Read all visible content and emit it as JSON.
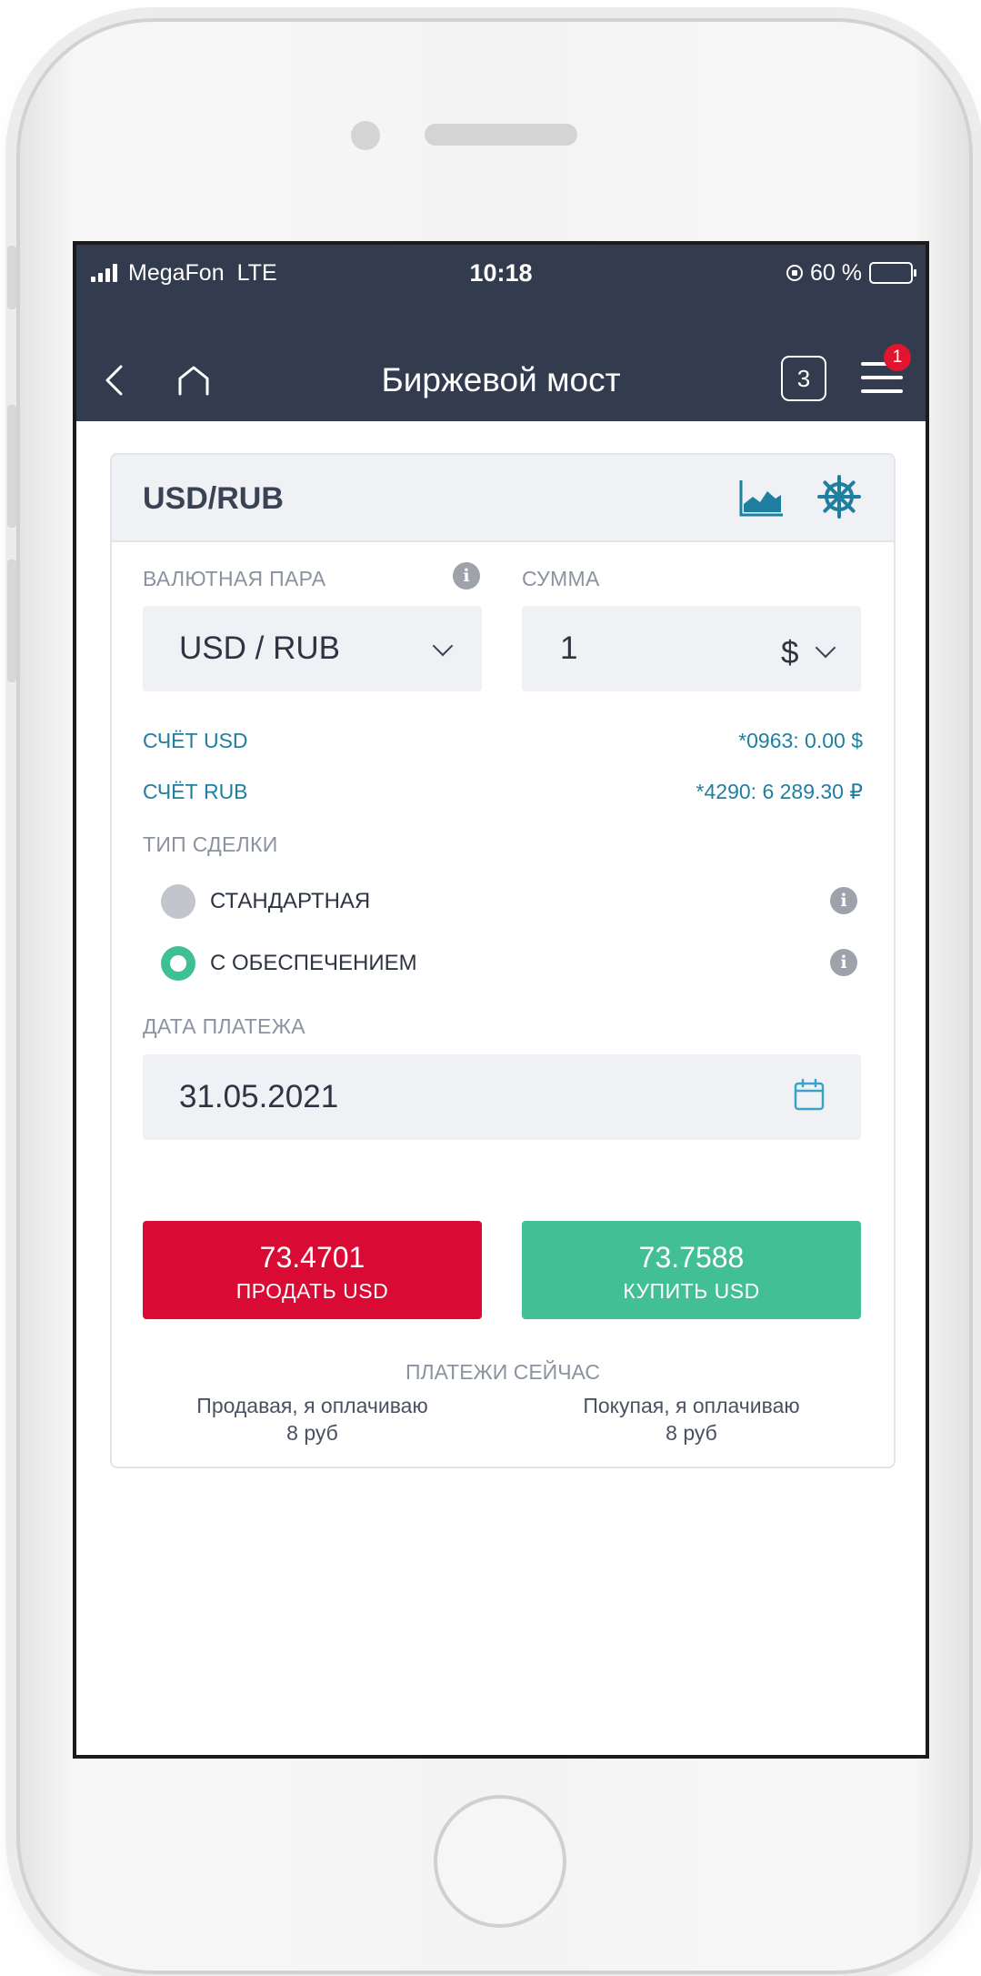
{
  "status_bar": {
    "carrier": "MegaFon",
    "network": "LTE",
    "time": "10:18",
    "battery_text": "60 %",
    "battery_level": 0.6
  },
  "nav": {
    "title": "Биржевой мост",
    "counter": "3",
    "menu_badge": "1"
  },
  "card": {
    "title": "USD/RUB",
    "pair_label": "ВАЛЮТНАЯ ПАРА",
    "pair_value": "USD / RUB",
    "amount_label": "СУММА",
    "amount_value": "1",
    "currency_symbol": "$",
    "accounts": [
      {
        "label": "СЧЁТ USD",
        "value": "*0963: 0.00 $"
      },
      {
        "label": "СЧЁТ RUB",
        "value": "*4290: 6 289.30 ₽"
      }
    ],
    "deal_type_label": "ТИП СДЕЛКИ",
    "deal_types": [
      {
        "label": "СТАНДАРТНАЯ",
        "selected": false
      },
      {
        "label": "С ОБЕСПЕЧЕНИЕМ",
        "selected": true
      }
    ],
    "payment_date_label": "ДАТА ПЛАТЕЖА",
    "payment_date": "31.05.2021",
    "sell": {
      "price": "73.4701",
      "caption": "ПРОДАТЬ USD"
    },
    "buy": {
      "price": "73.7588",
      "caption": "КУПИТЬ USD"
    },
    "payments_title": "ПЛАТЕЖИ СЕЙЧАС",
    "sell_payment_line1": "Продавая, я оплачиваю",
    "sell_payment_line2": "8 руб",
    "buy_payment_line1": "Покупая, я оплачиваю",
    "buy_payment_line2": "8 руб"
  },
  "icons": {
    "back": "chevron-left-icon",
    "home": "home-icon",
    "menu": "hamburger-menu-icon",
    "chart": "area-chart-icon",
    "settings": "ship-wheel-icon",
    "info": "info-icon",
    "calendar": "calendar-icon"
  },
  "colors": {
    "topbar": "#323c4e",
    "sell": "#d90b35",
    "buy": "#43bf96",
    "accent": "#1f7fa0",
    "radio_selected": "#3fbf95",
    "badge": "#e0152f"
  }
}
